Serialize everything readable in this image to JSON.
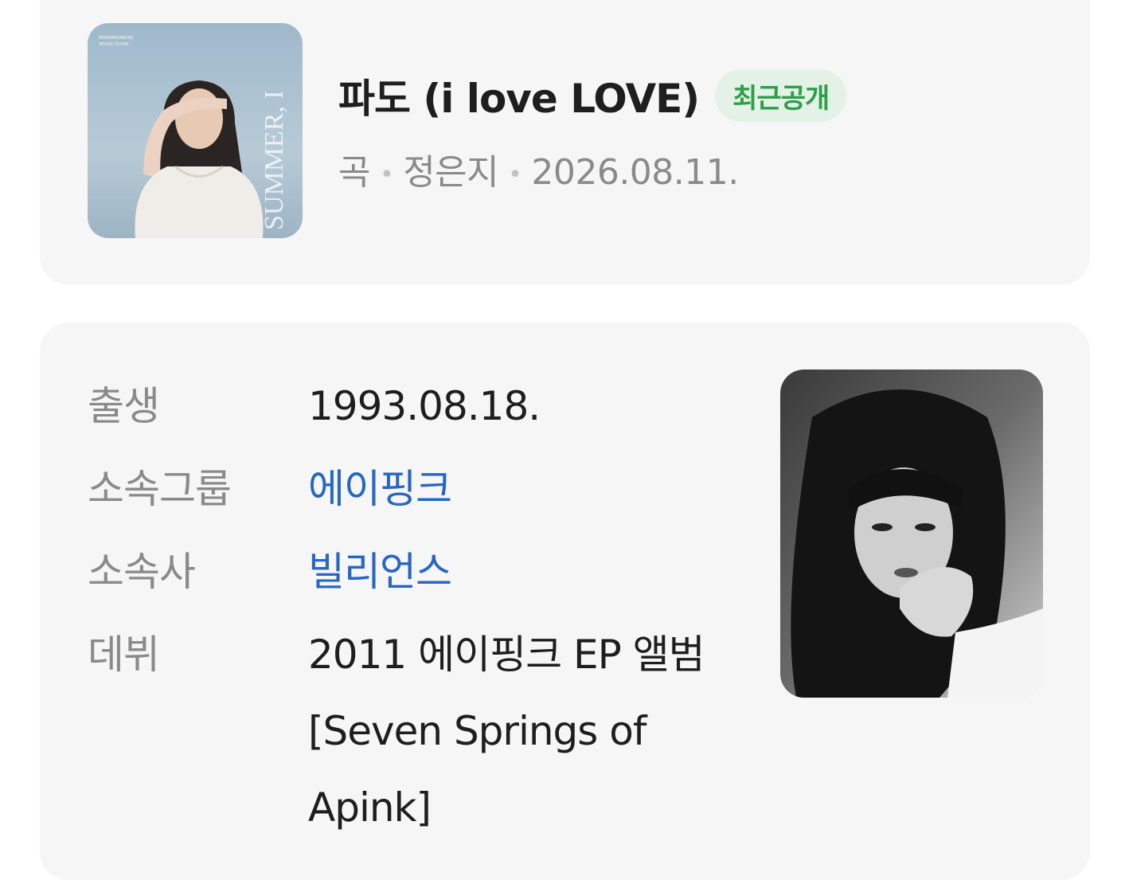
{
  "song": {
    "title": "파도 (i love LOVE)",
    "badge": "최근공개",
    "type": "곡",
    "artist": "정은지",
    "date": "2026.08.11.",
    "cover_text": "SUMMER, I",
    "cover_small_text_1": "HOSHINOMUSE",
    "cover_small_text_2": "JEONG EUNJI"
  },
  "profile": {
    "rows": [
      {
        "label": "출생",
        "value": "1993.08.18."
      },
      {
        "label": "소속그룹",
        "value": "에이핑크"
      },
      {
        "label": "소속사",
        "value": "빌리언스"
      },
      {
        "label": "데뷔",
        "value": "2011 에이핑크 EP 앨범 [Seven Springs of Apink]"
      }
    ]
  },
  "colors": {
    "card_bg": "#f6f6f6",
    "badge_bg": "#e3f1e6",
    "badge_text": "#2e9e4a",
    "link": "#2667c4",
    "muted": "#8a8a8a",
    "text": "#1e1e1e"
  }
}
